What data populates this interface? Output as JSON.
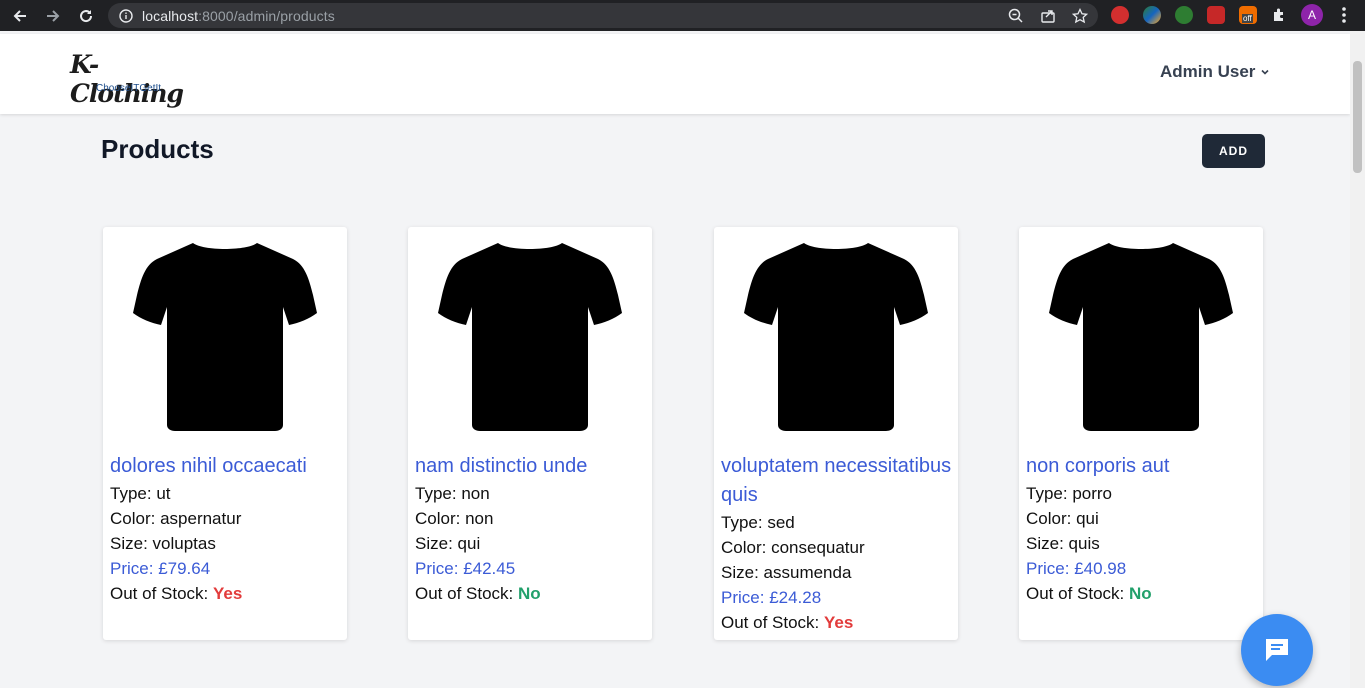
{
  "browser": {
    "url_host": "localhost",
    "url_rest": ":8000/admin/products",
    "profile_initial": "A",
    "ext_badge": "off"
  },
  "nav": {
    "brand": "K-Clothing",
    "tagline": "ChooseITGetIt",
    "user_label": "Admin User"
  },
  "main": {
    "title": "Products",
    "add_label": "ADD"
  },
  "labels": {
    "type": "Type: ",
    "color": "Color: ",
    "size": "Size: ",
    "price": "Price: ",
    "stock": "Out of Stock: "
  },
  "products": [
    {
      "name": "dolores nihil occaecati",
      "type": "ut",
      "color": "aspernatur",
      "size": "voluptas",
      "price": "£79.64",
      "out_of_stock": "Yes"
    },
    {
      "name": "nam distinctio unde",
      "type": "non",
      "color": "non",
      "size": "qui",
      "price": "£42.45",
      "out_of_stock": "No"
    },
    {
      "name": "voluptatem necessitatibus quis",
      "type": "sed",
      "color": "consequatur",
      "size": "assumenda",
      "price": "£24.28",
      "out_of_stock": "Yes"
    },
    {
      "name": "non corporis aut",
      "type": "porro",
      "color": "qui",
      "size": "quis",
      "price": "£40.98",
      "out_of_stock": "No"
    }
  ],
  "colors": {
    "accent": "#3b5bd6",
    "yes": "#e23b3b",
    "no": "#22a06b",
    "dark_button": "#1f2937",
    "chat": "#3b8cf2"
  },
  "icons": [
    "back-arrow-icon",
    "forward-arrow-icon",
    "reload-icon",
    "info-icon",
    "zoom-icon",
    "share-icon",
    "star-icon",
    "extension-icon",
    "chevron-down-icon",
    "tshirt-icon",
    "chat-icon",
    "kebab-menu-icon"
  ]
}
